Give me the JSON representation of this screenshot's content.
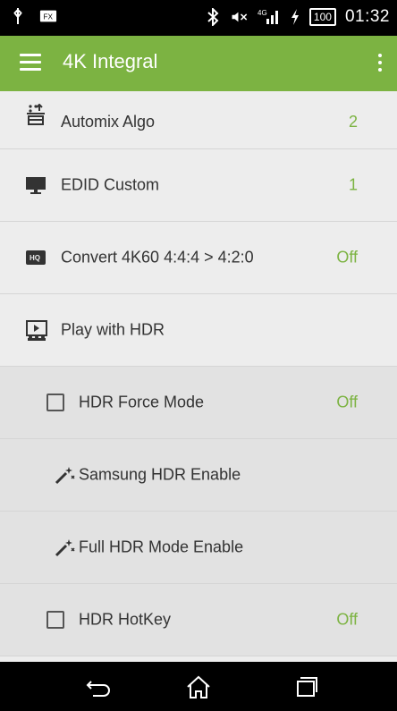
{
  "status_bar": {
    "left_icons": [
      "usb-icon",
      "fx-notification-icon"
    ],
    "right_icons": [
      "bluetooth-icon",
      "mute-icon",
      "signal-4g-icon",
      "charging-icon"
    ],
    "network": "4G",
    "battery": "100",
    "time": "01:32"
  },
  "app_bar": {
    "title": "4K Integral"
  },
  "items": [
    {
      "label": "Automix Algo",
      "value": "2",
      "icon": "automix-icon"
    },
    {
      "label": "EDID Custom",
      "value": "1",
      "icon": "monitor-icon"
    },
    {
      "label": "Convert 4K60 4:4:4 > 4:2:0",
      "value": "Off",
      "icon": "hq-icon"
    },
    {
      "label": "Play with HDR",
      "value": "",
      "icon": "hdr-play-icon"
    },
    {
      "label": "HDR Force Mode",
      "value": "Off",
      "icon": "checkbox-icon"
    },
    {
      "label": "Samsung HDR Enable",
      "value": "",
      "icon": "magic-wand-icon"
    },
    {
      "label": "Full HDR Mode Enable",
      "value": "",
      "icon": "magic-wand-icon"
    },
    {
      "label": "HDR HotKey",
      "value": "Off",
      "icon": "checkbox-icon"
    }
  ],
  "colors": {
    "accent": "#7cb342",
    "list_bg": "#ededed",
    "sub_bg": "#e2e2e2"
  },
  "nav_bar": {
    "buttons": [
      "back-icon",
      "home-icon",
      "recents-icon"
    ]
  }
}
